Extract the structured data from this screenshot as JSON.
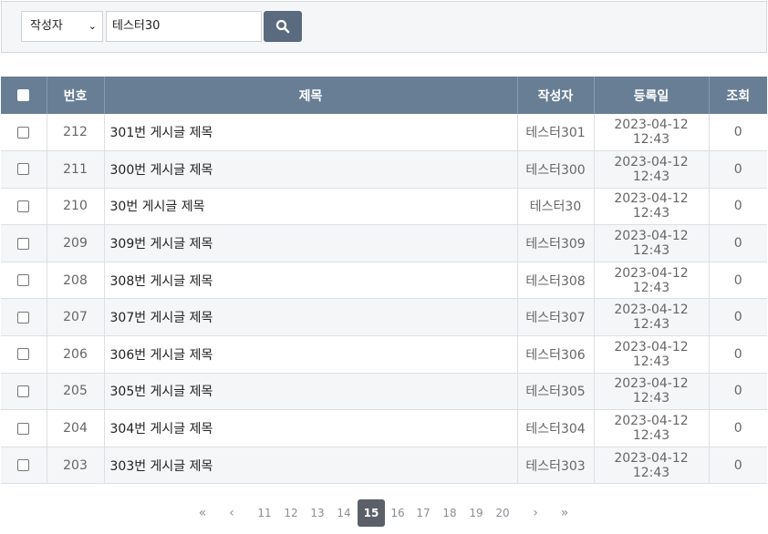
{
  "search": {
    "field": "작성자",
    "query": "테스터30"
  },
  "table": {
    "columns": [
      "번호",
      "제목",
      "작성자",
      "등록일",
      "조회"
    ],
    "rows": [
      {
        "no": "212",
        "title": "301번 게시글 제목",
        "author": "테스터301",
        "date": "2023-04-12 12:43",
        "views": "0"
      },
      {
        "no": "211",
        "title": "300번 게시글 제목",
        "author": "테스터300",
        "date": "2023-04-12 12:43",
        "views": "0"
      },
      {
        "no": "210",
        "title": "30번 게시글 제목",
        "author": "테스터30",
        "date": "2023-04-12 12:43",
        "views": "0"
      },
      {
        "no": "209",
        "title": "309번 게시글 제목",
        "author": "테스터309",
        "date": "2023-04-12 12:43",
        "views": "0"
      },
      {
        "no": "208",
        "title": "308번 게시글 제목",
        "author": "테스터308",
        "date": "2023-04-12 12:43",
        "views": "0"
      },
      {
        "no": "207",
        "title": "307번 게시글 제목",
        "author": "테스터307",
        "date": "2023-04-12 12:43",
        "views": "0"
      },
      {
        "no": "206",
        "title": "306번 게시글 제목",
        "author": "테스터306",
        "date": "2023-04-12 12:43",
        "views": "0"
      },
      {
        "no": "205",
        "title": "305번 게시글 제목",
        "author": "테스터305",
        "date": "2023-04-12 12:43",
        "views": "0"
      },
      {
        "no": "204",
        "title": "304번 게시글 제목",
        "author": "테스터304",
        "date": "2023-04-12 12:43",
        "views": "0"
      },
      {
        "no": "203",
        "title": "303번 게시글 제목",
        "author": "테스터303",
        "date": "2023-04-12 12:43",
        "views": "0"
      }
    ]
  },
  "pagination": {
    "first": "«",
    "prev": "‹",
    "pages": [
      "11",
      "12",
      "13",
      "14",
      "15",
      "16",
      "17",
      "18",
      "19",
      "20"
    ],
    "current": "15",
    "next": "›",
    "last": "»"
  },
  "colors": {
    "header_bg": "#687e94",
    "search_button_bg": "#5a6b80",
    "active_page_bg": "#5b6068"
  }
}
